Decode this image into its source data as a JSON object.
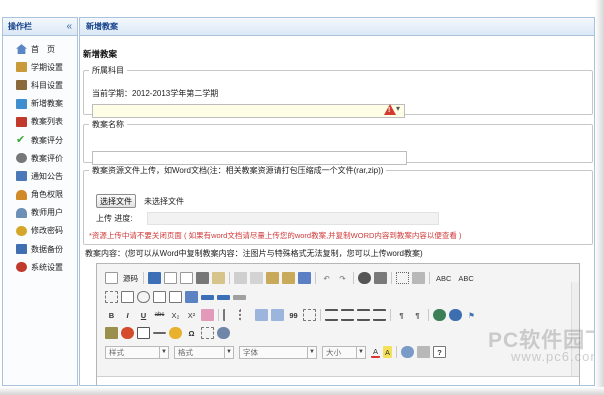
{
  "sidebar": {
    "title": "操作栏",
    "collapse_glyph": "«",
    "items": [
      {
        "label": "首　页",
        "icon": "home-icon",
        "color": "#5a86c6"
      },
      {
        "label": "学期设置",
        "icon": "calendar-icon",
        "color": "#c89a3a"
      },
      {
        "label": "科目设置",
        "icon": "book-icon",
        "color": "#8a6a3a"
      },
      {
        "label": "新增教案",
        "icon": "add-document-icon",
        "color": "#3f8fd0"
      },
      {
        "label": "教案列表",
        "icon": "list-icon",
        "color": "#c0392b"
      },
      {
        "label": "教案评分",
        "icon": "checkmark-icon",
        "color": "#3aa53a"
      },
      {
        "label": "教案评价",
        "icon": "comment-icon",
        "color": "#777777"
      },
      {
        "label": "通知公告",
        "icon": "notice-icon",
        "color": "#4b79b7"
      },
      {
        "label": "角色权限",
        "icon": "role-icon",
        "color": "#d08a2a"
      },
      {
        "label": "教师用户",
        "icon": "user-group-icon",
        "color": "#6b8fb6"
      },
      {
        "label": "修改密码",
        "icon": "key-icon",
        "color": "#d4a62a"
      },
      {
        "label": "数据备份",
        "icon": "database-icon",
        "color": "#3f6fb0"
      },
      {
        "label": "系统设置",
        "icon": "settings-icon",
        "color": "#c0392b"
      }
    ]
  },
  "main": {
    "tab_title": "新增教案",
    "page_title": "新增教案",
    "subject": {
      "legend": "所属科目",
      "current_term": "当前学期：2012-2013学年第二学期",
      "warning_icon": "warning-icon",
      "warning_color": "#d43b2f"
    },
    "name": {
      "legend": "教案名称",
      "value": ""
    },
    "file": {
      "legend": "教案资源文件上传，如Word文档(注：相关教案资源请打包压缩成一个文件(rar,zip))",
      "choose_button": "选择文件",
      "no_file": "未选择文件",
      "progress_label": "上传 进度:",
      "progress": 0,
      "notice": "*资源上传中请不要关闭页面 ( 如果有word文档请尽量上传您的word教案,并复制WORD内容到教案内容以便查看 )"
    },
    "content_label": "教案内容：(您可以从Word中复制教案内容：注图片与特殊格式无法复制，您可以上传word教案)"
  },
  "editor": {
    "source_label": "源码",
    "style_placeholder": "样式",
    "format_placeholder": "格式",
    "font_placeholder": "字体",
    "size_placeholder": "大小",
    "subscript_label": "X₂",
    "superscript_label": "X²",
    "bold_label": "B",
    "italic_label": "I",
    "underline_label": "U",
    "strike_label": "abc",
    "text_color_label": "A",
    "bg_color_label": "A",
    "omega_label": "Ω",
    "quote_label": "99",
    "help_label": "?",
    "spell_label": "ABC"
  },
  "watermark": {
    "line1": "PC软件园下载",
    "line2": "www.pc6.com"
  },
  "colors": {
    "border": "#a9c3dd",
    "header_text": "#15428b",
    "notice": "#d03a3a",
    "select_bg": "#fefde6"
  }
}
